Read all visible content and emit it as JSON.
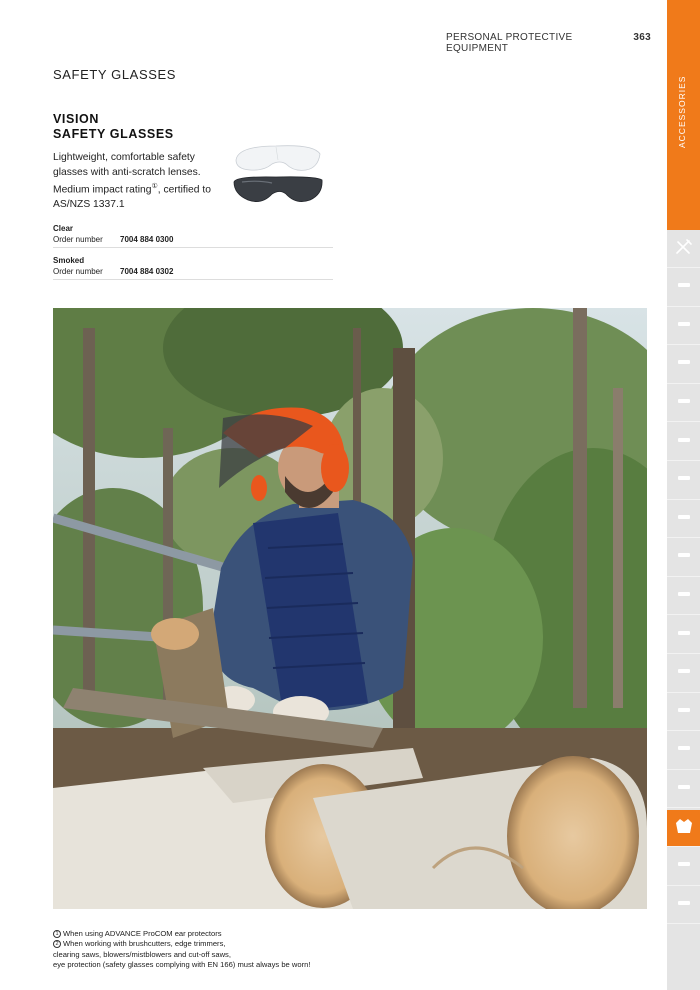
{
  "header": {
    "section": "PERSONAL PROTECTIVE EQUIPMENT",
    "page_number": "363"
  },
  "section_title": "SAFETY GLASSES",
  "product": {
    "title_line1": "VISION",
    "title_line2": "SAFETY GLASSES",
    "desc_part1": "Lightweight, comfortable safety glasses with anti-scratch lenses. Medium impact rating",
    "desc_marker": "①",
    "desc_part2": ", certified to AS/NZS 1337.1",
    "variants": [
      {
        "name": "Clear",
        "order_label": "Order number",
        "order_number": "7004 884 0300"
      },
      {
        "name": "Smoked",
        "order_label": "Order number",
        "order_number": "7004 884 0302"
      }
    ]
  },
  "footnotes": {
    "note1_marker": "1",
    "note1": "When using ADVANCE ProCOM ear protectors",
    "note2_marker": "2",
    "note2_line1": "When working with brushcutters, edge trimmers,",
    "note2_line2": "clearing saws, blowers/mistblowers and cut-off saws,",
    "note2_line3": "eye protection (safety glasses complying with EN 166) must always be worn!"
  },
  "sidebar": {
    "label": "ACCESSORIES",
    "accent_color": "#f07a1a",
    "tabs": [
      {
        "icon": "tools-icon"
      },
      {
        "icon": "chainsaw-icon"
      },
      {
        "icon": "chainsaw-icon"
      },
      {
        "icon": "cutoff-saw-icon"
      },
      {
        "icon": "pole-saw-icon"
      },
      {
        "icon": "trimmer-icon"
      },
      {
        "icon": "blower-icon"
      },
      {
        "icon": "sprayer-icon"
      },
      {
        "icon": "brushcutter-icon"
      },
      {
        "icon": "hedge-trimmer-icon"
      },
      {
        "icon": "pressure-washer-icon"
      },
      {
        "icon": "edger-icon"
      },
      {
        "icon": "vacuum-icon"
      },
      {
        "icon": "battery-icon"
      },
      {
        "icon": "oil-can-icon"
      },
      {
        "icon": "protective-jacket-icon"
      },
      {
        "icon": "axe-icon"
      },
      {
        "icon": "shirt-icon"
      }
    ],
    "active_tab": "protective-jacket-icon"
  }
}
